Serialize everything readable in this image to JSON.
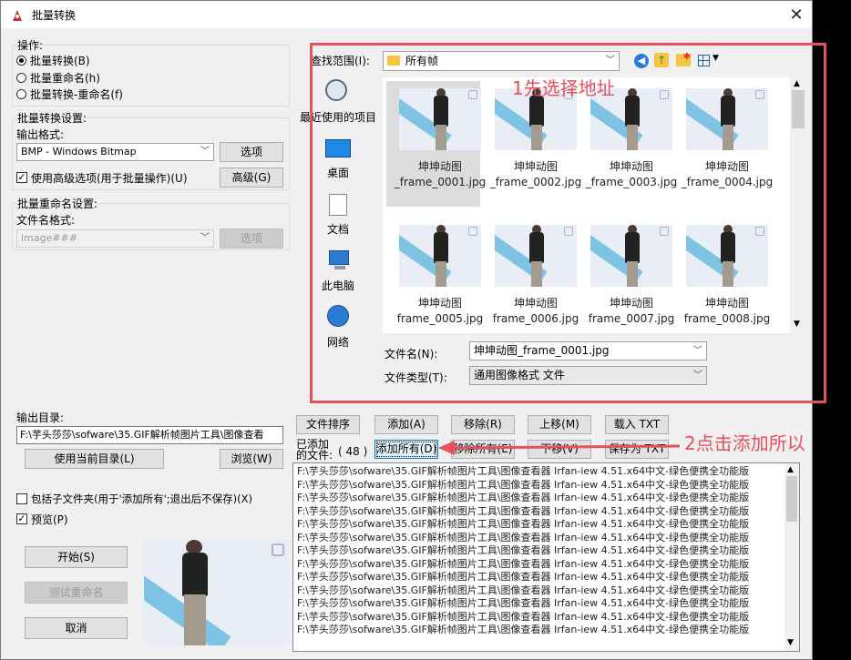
{
  "window": {
    "title": "批量转换",
    "close": "✕"
  },
  "operations": {
    "label": "操作:",
    "options": [
      "批量转换(B)",
      "批量重命名(h)",
      "批量转换-重命名(f)"
    ],
    "selected": 0
  },
  "batch_convert": {
    "label": "批量转换设置:",
    "output_format_label": "输出格式:",
    "output_format_value": "BMP - Windows Bitmap",
    "options_button": "选项",
    "advanced_check_label": "使用高级选项(用于批量操作)(U)",
    "advanced_checked": true,
    "advanced_button": "高级(G)"
  },
  "batch_rename": {
    "label": "批量重命名设置:",
    "pattern_label": "文件名格式:",
    "pattern_value": "image###",
    "options_button": "选项"
  },
  "output_dir": {
    "label": "输出目录:",
    "value": "F:\\芋头莎莎\\sofware\\35.GIF解析帧图片工具\\图像查看",
    "use_current_button": "使用当前目录(L)",
    "browse_button": "浏览(W)"
  },
  "include_subfolders": {
    "label": "包括子文件夹(用于'添加所有';退出后不保存)(X)",
    "checked": false
  },
  "preview": {
    "label": "预览(P)",
    "checked": true
  },
  "actions": {
    "start": "开始(S)",
    "test_rename": "测试重命名",
    "cancel": "取消"
  },
  "browser": {
    "lookin_label": "查找范围(I):",
    "lookin_value": "所有帧",
    "places": [
      "最近使用的项目",
      "桌面",
      "文档",
      "此电脑",
      "网络"
    ],
    "files": [
      [
        "坤坤动图",
        "_frame_0001.jpg"
      ],
      [
        "坤坤动图",
        "_frame_0002.jpg"
      ],
      [
        "坤坤动图",
        "_frame_0003.jpg"
      ],
      [
        "坤坤动图",
        "_frame_0004.jpg"
      ],
      [
        "坤坤动图",
        "frame_0005.jpg"
      ],
      [
        "坤坤动图",
        "frame_0006.jpg"
      ],
      [
        "坤坤动图",
        "frame_0007.jpg"
      ],
      [
        "坤坤动图",
        "frame_0008.jpg"
      ]
    ],
    "filename_label": "文件名(N):",
    "filename_value": "坤坤动图_frame_0001.jpg",
    "filetype_label": "文件类型(T):",
    "filetype_value": "通用图像格式 文件"
  },
  "file_buttons": {
    "sort": "文件排序",
    "add": "添加(A)",
    "remove": "移除(R)",
    "move_up": "上移(M)",
    "load_txt": "载入 TXT",
    "add_all": "添加所有(D)",
    "remove_all": "移除所有(E)",
    "move_down": "下移(V)",
    "save_txt": "保存为 TXT"
  },
  "added": {
    "label_1": "已添加",
    "label_2": "的文件:",
    "count": "( 48 )"
  },
  "added_list": {
    "line": "F:\\芋头莎莎\\sofware\\35.GIF解析帧图片工具\\图像查看器 Irfan-iew 4.51.x64中文-绿色便携全功能版",
    "rows": 13
  },
  "annotations": {
    "step1": "1先选择地址",
    "step2": "2点击添加所以",
    "color": "#e8505b"
  }
}
